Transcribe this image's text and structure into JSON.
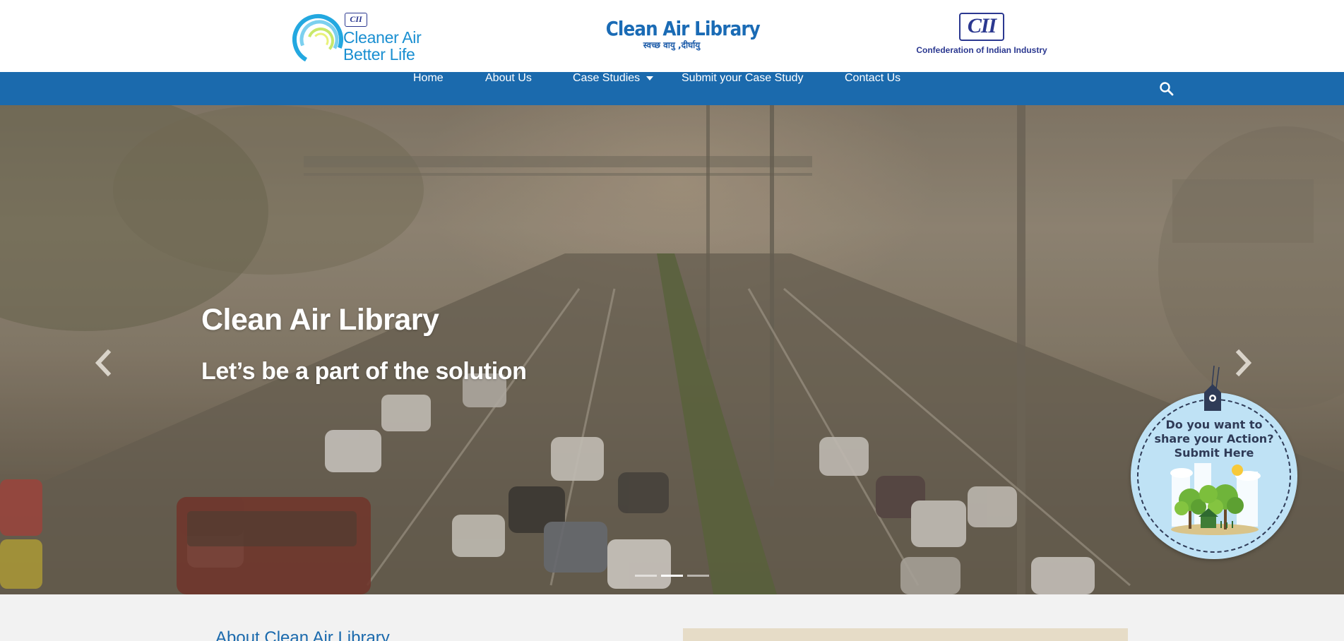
{
  "header": {
    "left_logo": {
      "badge": "CII",
      "line1": "Cleaner Air",
      "line2": "Better Life"
    },
    "center_logo": {
      "title": "Clean Air Library",
      "tagline": "स्वच्छ वायु ,दीर्घायु"
    },
    "right_logo": {
      "mark": "CII",
      "caption": "Confederation of Indian Industry"
    }
  },
  "nav": {
    "items": [
      {
        "label": "Home"
      },
      {
        "label": "About Us"
      },
      {
        "label": "Case Studies"
      },
      {
        "label": "Submit your Case Study"
      },
      {
        "label": "Contact Us"
      }
    ],
    "search_icon": "search-icon"
  },
  "hero": {
    "title": "Clean Air Library",
    "subtitle": "Let’s be a part of the solution",
    "slides_total": 3,
    "active_slide": 2,
    "prev_icon": "chevron-left-icon",
    "next_icon": "chevron-right-icon"
  },
  "floating_badge": {
    "line1": "Do you want to",
    "line2": "share your Action?",
    "line3": "Submit Here"
  },
  "about": {
    "heading": "About Clean Air Library"
  },
  "colors": {
    "nav_background": "#1b6aad",
    "brand_blue": "#1a6bb5",
    "cii_navy": "#2b3890",
    "badge_background": "#bfe2f5",
    "page_background": "#f2f2f2"
  }
}
